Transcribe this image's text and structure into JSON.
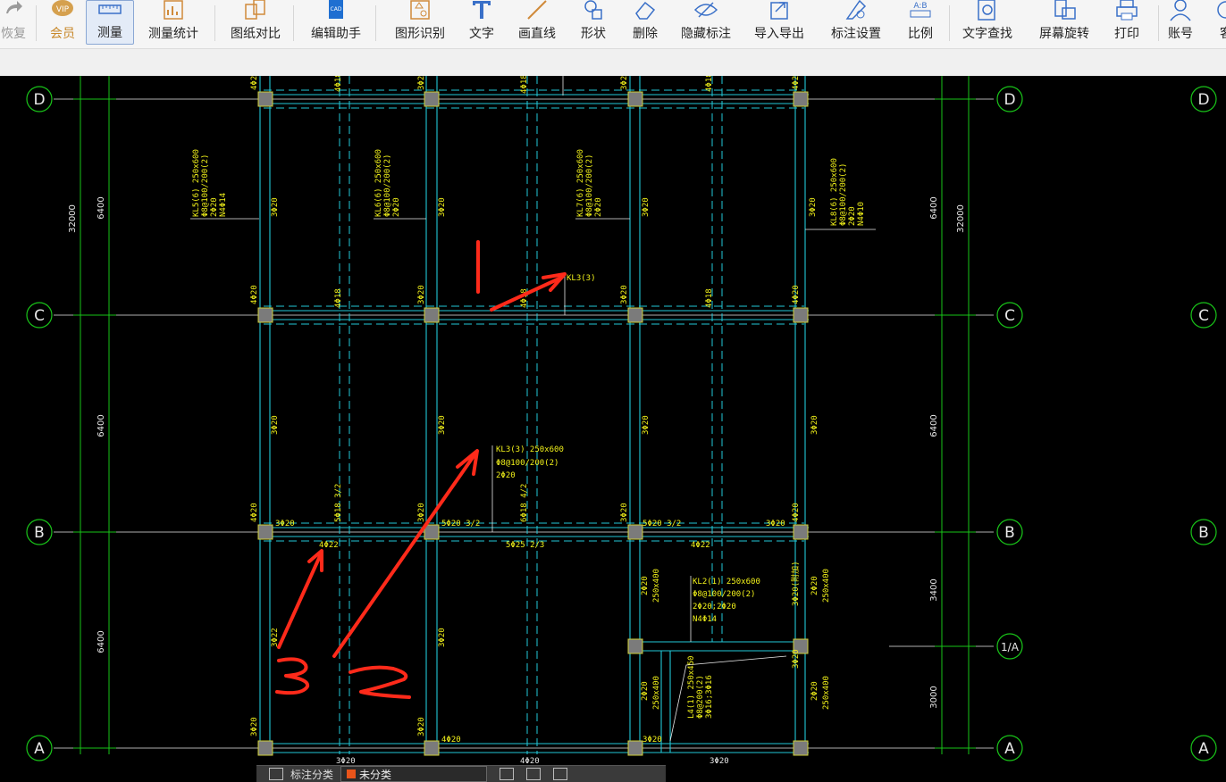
{
  "toolbar": {
    "items": [
      {
        "label": "恢复",
        "icon": "redo-icon",
        "state": "disabled"
      },
      {
        "label": "会员",
        "icon": "vip-icon",
        "state": "vip"
      },
      {
        "label": "测量",
        "icon": "ruler-icon",
        "state": "active"
      },
      {
        "label": "测量统计",
        "icon": "measure-stats-icon",
        "state": "normal"
      },
      {
        "label": "图纸对比",
        "icon": "compare-icon",
        "state": "normal"
      },
      {
        "label": "编辑助手",
        "icon": "cad-edit-icon",
        "state": "normal"
      },
      {
        "label": "图形识别",
        "icon": "shape-recognize-icon",
        "state": "normal"
      },
      {
        "label": "文字",
        "icon": "text-icon",
        "state": "normal"
      },
      {
        "label": "画直线",
        "icon": "line-icon",
        "state": "normal"
      },
      {
        "label": "形状",
        "icon": "shape-icon",
        "state": "normal"
      },
      {
        "label": "删除",
        "icon": "eraser-icon",
        "state": "normal"
      },
      {
        "label": "隐藏标注",
        "icon": "eye-hide-icon",
        "state": "normal"
      },
      {
        "label": "导入导出",
        "icon": "import-export-icon",
        "state": "normal"
      },
      {
        "label": "标注设置",
        "icon": "annotation-settings-icon",
        "state": "normal"
      },
      {
        "label": "比例",
        "icon": "scale-icon",
        "state": "normal"
      },
      {
        "label": "文字查找",
        "icon": "text-search-icon",
        "state": "normal"
      },
      {
        "label": "屏幕旋转",
        "icon": "screen-rotate-icon",
        "state": "normal"
      },
      {
        "label": "打印",
        "icon": "printer-icon",
        "state": "normal"
      },
      {
        "label": "账号",
        "icon": "account-icon",
        "state": "normal"
      },
      {
        "label": "客",
        "icon": "service-icon",
        "state": "normal"
      }
    ]
  },
  "drawing": {
    "axes_rows": [
      "D",
      "C",
      "B",
      "1/A",
      "A"
    ],
    "dims_left": {
      "total": "32000",
      "d_c": "6400",
      "c_b": "6400",
      "b_a": "6400"
    },
    "dims_right": {
      "total": "32000",
      "d_c": "6400",
      "c_b": "6400",
      "b_1a": "3400",
      "1a_a": "3000"
    },
    "beam_labels": {
      "kl5": [
        "KL5(6) 250x600",
        "Φ8@100/200(2)",
        "2Φ20",
        "N4Φ14"
      ],
      "kl6": [
        "KL6(6) 250x600",
        "Φ8@100/200(2)",
        "2Φ20"
      ],
      "kl7": [
        "KL7(6) 250x600",
        "Φ8@100/200(2)",
        "2Φ20"
      ],
      "kl8": [
        "KL8(6) 250x600",
        "Φ8@100/200(2)",
        "2Φ20",
        "N4Φ10"
      ],
      "kl3_short": "KL3(3)",
      "kl3": [
        "KL3(3) 250x600",
        "Φ8@100/200(2)",
        "2Φ20"
      ],
      "kl2": [
        "KL2(1) 250x600",
        "Φ8@100/200(2)",
        "2Φ20;2Φ20",
        "N4Φ14"
      ],
      "l4": [
        "L4(1) 250x450",
        "Φ8@200(2)",
        "3Φ16;3Φ16"
      ]
    },
    "rebar": {
      "col_top_1": "4Φ20",
      "col_top_2": "4Φ18",
      "col_top_3": "3Φ20",
      "col_top_4": "4Φ18",
      "col_top_5": "3Φ20",
      "col_top_6": "4Φ18",
      "col_top_7": "4Φ20",
      "dc_1": "3Φ20",
      "dc_2": "3Φ20",
      "dc_3": "3Φ20",
      "dc_4": "3Φ20",
      "c_1": "4Φ20",
      "c_2": "4Φ18",
      "c_3": "3Φ20",
      "c_4": "4Φ18",
      "c_5": "3Φ20",
      "c_6": "4Φ18",
      "c_7": "4Φ20",
      "cb_1": "3Φ20",
      "cb_2": "3Φ20",
      "cb_3": "3Φ20",
      "cb_4": "3Φ20",
      "b_1": "4Φ20",
      "b_2": "3Φ20",
      "b_3": "5Φ18 3/2",
      "b_4": "3Φ20",
      "b_5": "5Φ20 3/2",
      "b_6": "6Φ18 4/2",
      "b_7": "3Φ20",
      "b_8": "5Φ20 3/2",
      "b_9": "3Φ20",
      "b_10": "4Φ20",
      "b_bot_1": "4Φ22",
      "b_bot_2": "5Φ25 2/3",
      "b_bot_3": "4Φ22",
      "ba_1": "3Φ22",
      "ba_2": "3Φ20",
      "ba_3": "2Φ20",
      "ba_3b": "250x400",
      "ba_4": "3Φ20(附加)",
      "ba_5": "2Φ20",
      "ba_5b": "250x400",
      "ba_6": "2Φ20",
      "ba_6b": "250x400",
      "ba_7": "2Φ20",
      "ba_7b": "250x400",
      "ba_8": "3Φ20",
      "a_1": "3Φ20",
      "a_2": "3Φ20",
      "a_3": "4Φ20",
      "a_4": "3Φ20",
      "a_bot_1": "3Φ20",
      "a_bot_2": "4Φ20",
      "a_bot_3": "3Φ20"
    },
    "handwritten": {
      "mark1": "1",
      "mark2": "2",
      "mark3": "3"
    }
  },
  "bottom_panel": {
    "label": "标注分类",
    "select_value": "未分类"
  }
}
